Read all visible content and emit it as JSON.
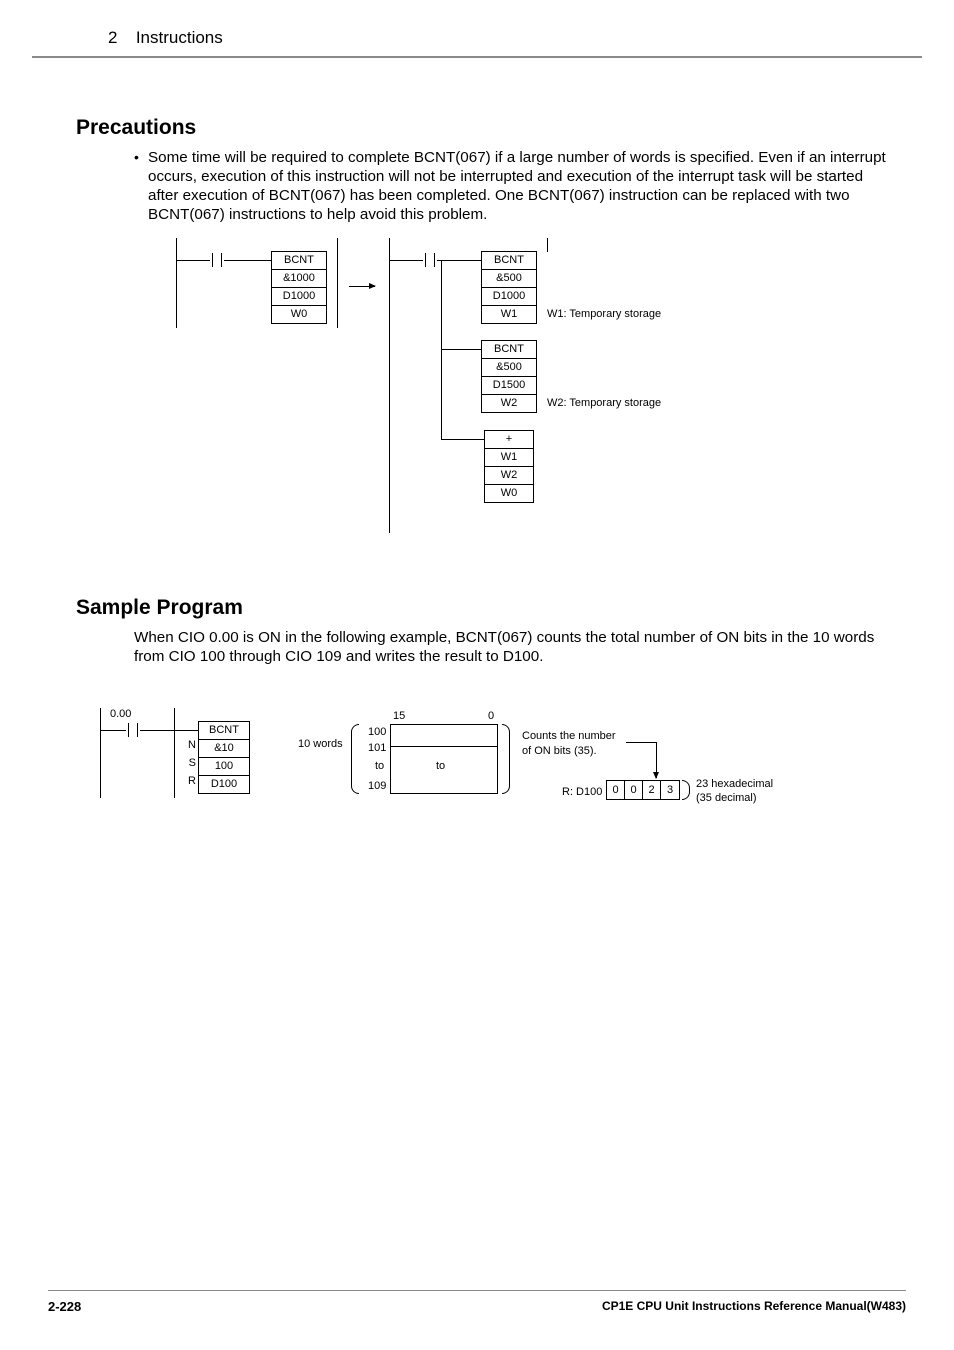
{
  "header": {
    "section_no": "2",
    "section_title": "Instructions"
  },
  "precautions": {
    "title": "Precautions",
    "bullet": "Some time will be required to complete BCNT(067) if a large number of words is specified. Even if an interrupt occurs, execution of this instruction will not be interrupted and execution of the interrupt task will be started after execution of BCNT(067) has been completed.  One BCNT(067) instruction can be replaced with two BCNT(067) instructions to help avoid this problem."
  },
  "dia1": {
    "left_block": {
      "r0": "BCNT",
      "r1": "&1000",
      "r2": "D1000",
      "r3": "W0"
    },
    "right_block1": {
      "r0": "BCNT",
      "r1": "&500",
      "r2": "D1000",
      "r3": "W1"
    },
    "right_block2": {
      "r0": "BCNT",
      "r1": "&500",
      "r2": "D1500",
      "r3": "W2"
    },
    "right_block3": {
      "r0": "+",
      "r1": "W1",
      "r2": "W2",
      "r3": "W0"
    },
    "label_w1": "W1: Temporary storage",
    "label_w2": "W2: Temporary storage"
  },
  "sample": {
    "title": "Sample Program",
    "body": "When CIO 0.00 is ON in the following example, BCNT(067) counts the total number of ON bits in the 10 words from CIO 100 through CIO 109 and writes the result to D100."
  },
  "dia2": {
    "contact": "0.00",
    "block": {
      "r0": "BCNT",
      "r1": "&10",
      "r2": "100",
      "r3": "D100"
    },
    "params": {
      "n": "N",
      "s": "S",
      "r": "R"
    },
    "words_label": "10 words",
    "word_idx": {
      "a": "100",
      "b": "101",
      "c": "to",
      "d": "109"
    },
    "bits": {
      "hi": "15",
      "lo": "0",
      "to": "to"
    },
    "counts1": "Counts the number",
    "counts2": "of ON bits (35).",
    "result_label": "R: D100",
    "result": {
      "d0": "0",
      "d1": "0",
      "d2": "2",
      "d3": "3"
    },
    "hex": "23 hexadecimal",
    "dec": "(35 decimal)"
  },
  "footer": {
    "page": "2-228",
    "manual": "CP1E CPU Unit Instructions Reference Manual(W483)"
  }
}
